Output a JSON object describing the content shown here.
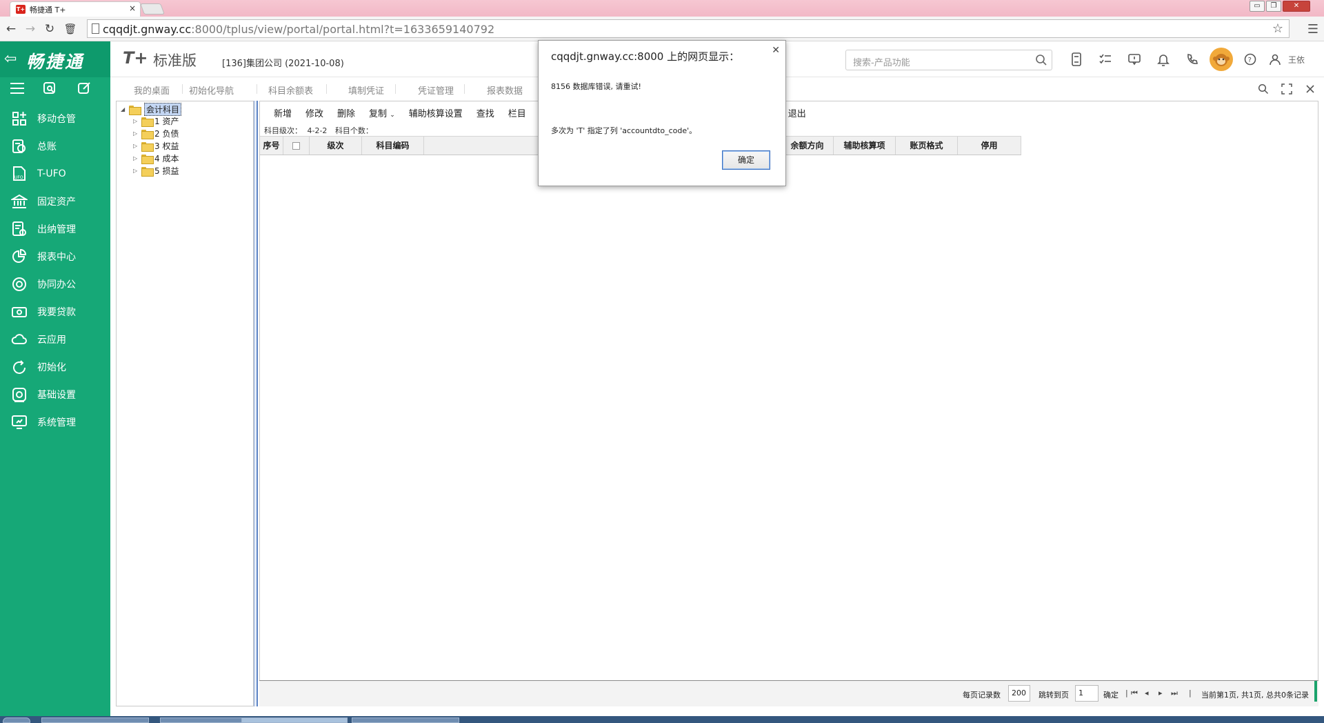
{
  "browser": {
    "tab_title": "畅捷通 T+",
    "favicon_text": "T+",
    "url_host": "cqqdjt.gnway.cc",
    "url_rest": ":8000/tplus/view/portal/portal.html?t=1633659140792"
  },
  "brand": {
    "name": "畅捷通"
  },
  "sidebar": {
    "items": [
      {
        "label": "移动仓管",
        "icon": "grid-plus-icon"
      },
      {
        "label": "总账",
        "icon": "ledger-icon"
      },
      {
        "label": "T-UFO",
        "icon": "ufo-doc-icon"
      },
      {
        "label": "固定资产",
        "icon": "bank-icon"
      },
      {
        "label": "出纳管理",
        "icon": "cashier-icon"
      },
      {
        "label": "报表中心",
        "icon": "pie-chart-icon"
      },
      {
        "label": "协同办公",
        "icon": "collaboration-icon"
      },
      {
        "label": "我要贷款",
        "icon": "money-icon"
      },
      {
        "label": "云应用",
        "icon": "cloud-icon"
      },
      {
        "label": "初始化",
        "icon": "refresh-icon"
      },
      {
        "label": "基础设置",
        "icon": "settings-gear-icon"
      },
      {
        "label": "系统管理",
        "icon": "system-monitor-icon"
      }
    ]
  },
  "header": {
    "logo_t": "T+",
    "logo_edition": "标准版",
    "company": "[136]集团公司   (2021-10-08)",
    "search_placeholder": "搜索-产品功能",
    "username": "王依"
  },
  "portal_tabs": [
    "我的桌面",
    "初始化导航",
    "科目余额表",
    "填制凭证",
    "凭证管理",
    "报表数据"
  ],
  "tree": {
    "root": "会计科目",
    "nodes": [
      "1 资产",
      "2 负债",
      "3 权益",
      "4 成本",
      "5 损益"
    ]
  },
  "toolbar": {
    "add": "新增",
    "edit": "修改",
    "delete": "删除",
    "copy": "复制",
    "aux_settings": "辅助核算设置",
    "find": "查找",
    "columns": "栏目",
    "exit": "退出"
  },
  "info": {
    "level_label": "科目级次：",
    "level_value": "4-2-2",
    "count_label": "科目个数："
  },
  "grid": {
    "headers_left": [
      "序号",
      "级次",
      "科目编码"
    ],
    "headers_right": [
      "余额方向",
      "辅助核算项",
      "账页格式",
      "停用"
    ]
  },
  "footer": {
    "per_page_label": "每页记录数",
    "per_page_value": "200",
    "jump_label": "跳转到页",
    "jump_value": "1",
    "confirm": "确定",
    "status": "当前第1页, 共1页, 总共0条记录"
  },
  "dialog": {
    "title": "cqqdjt.gnway.cc:8000 上的网页显示：",
    "message1": "8156 数据库错误, 请重试!",
    "message2": "多次为 'T' 指定了列 'accountdto_code'。",
    "ok": "确定"
  },
  "colors": {
    "sidebar": "#16a877",
    "brand": "#0e9a6c",
    "accent_blue": "#5d84c5"
  }
}
